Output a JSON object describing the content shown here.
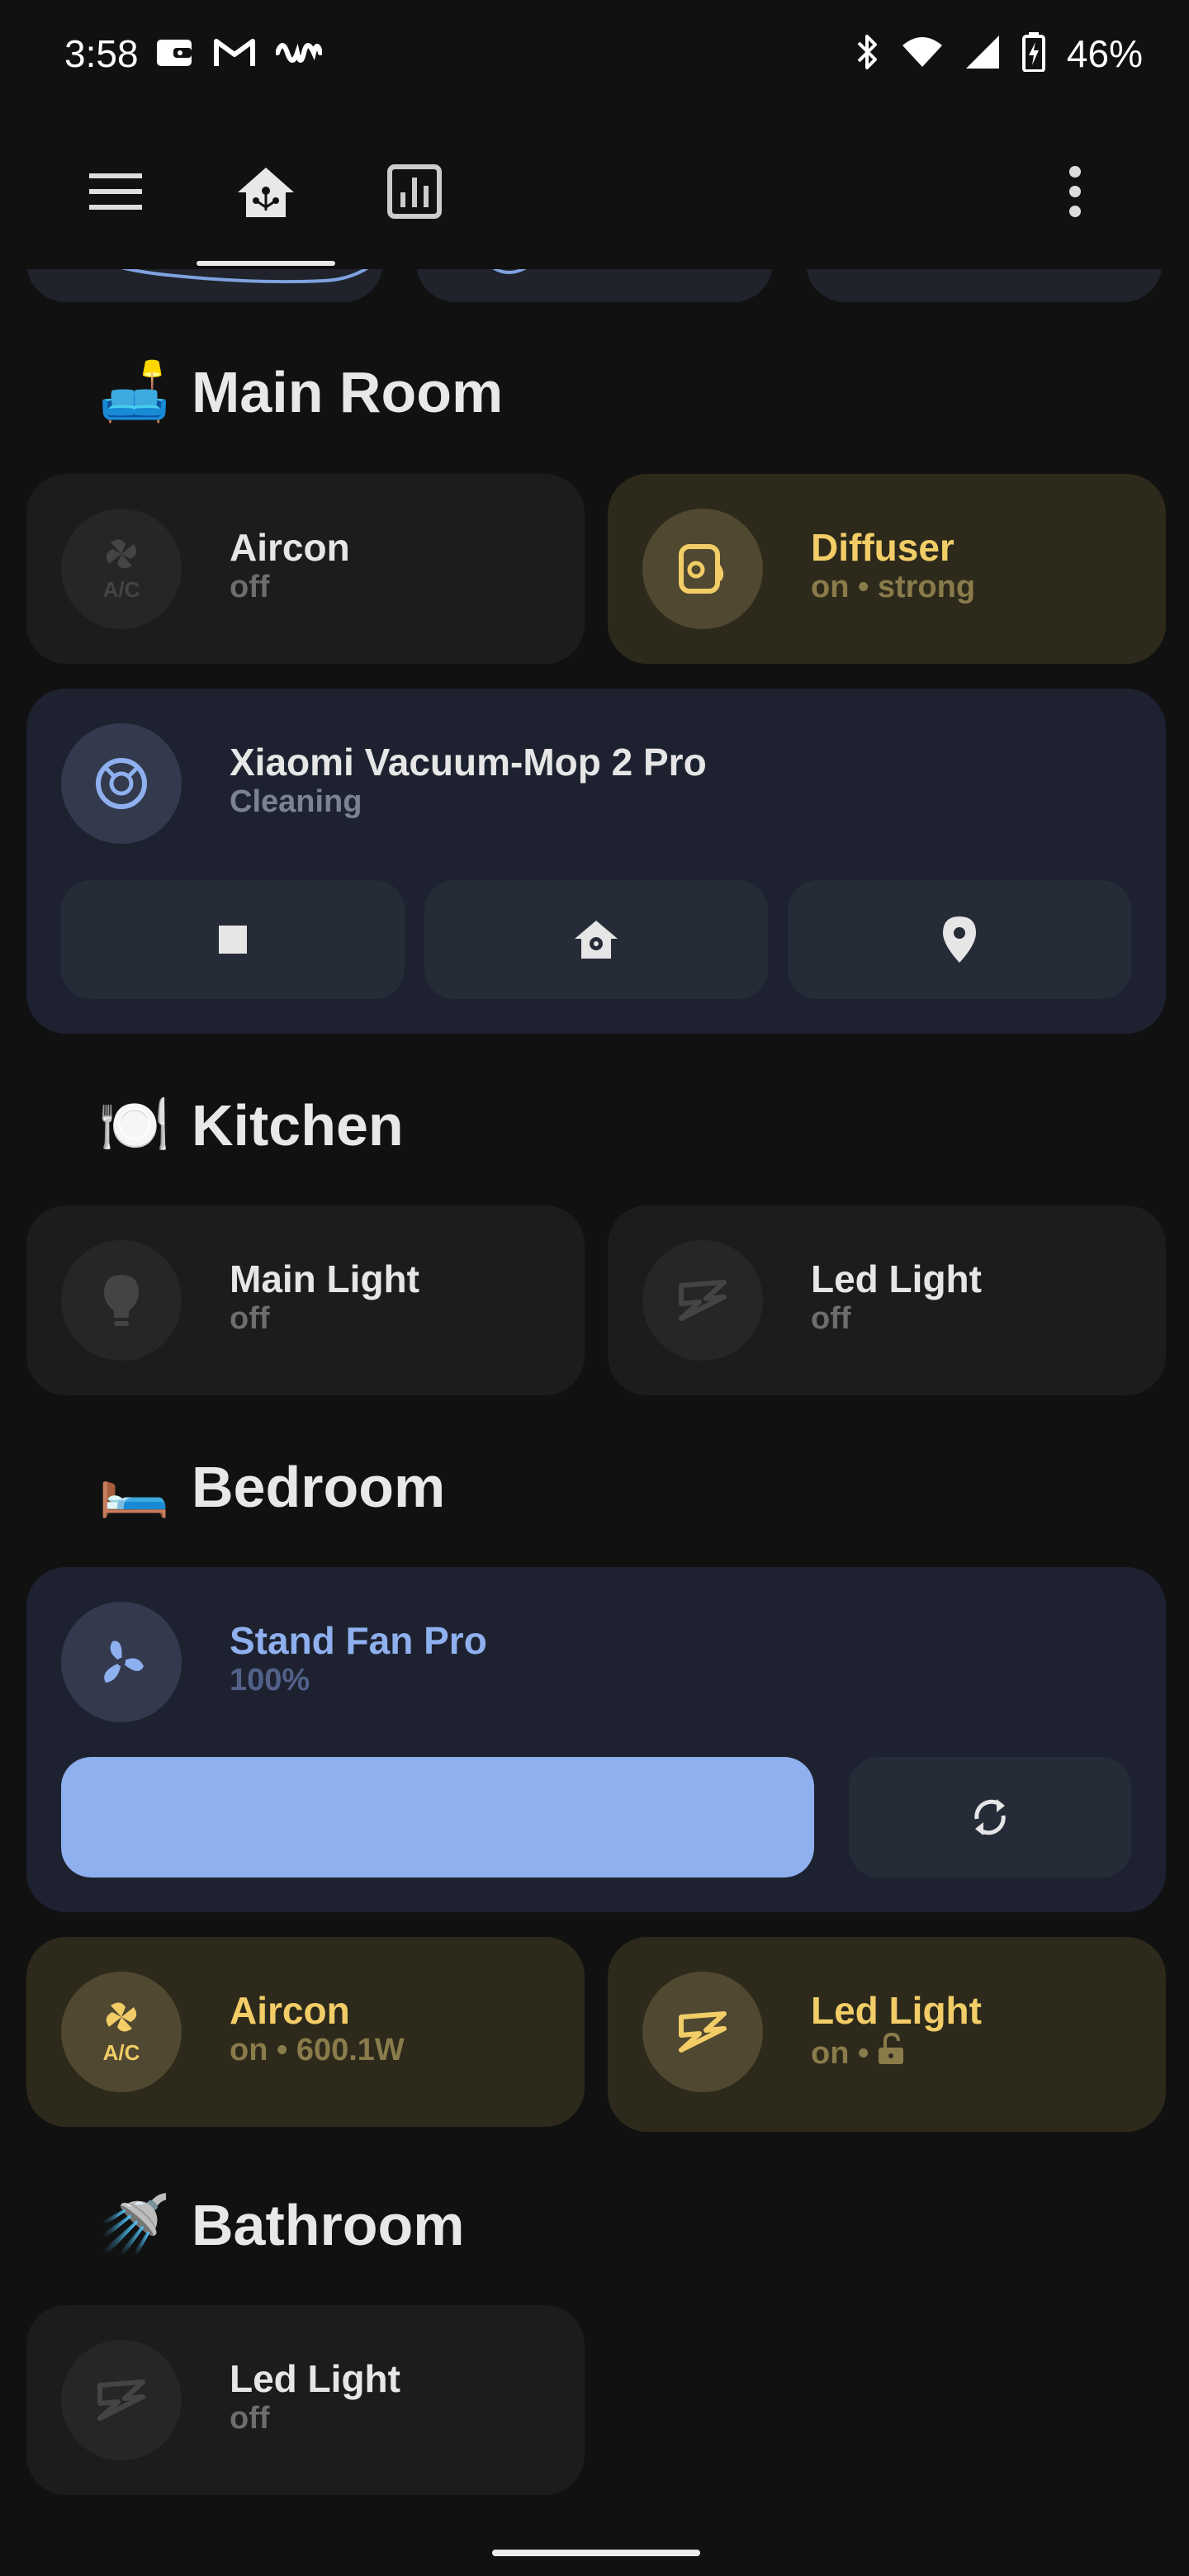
{
  "status_bar": {
    "time": "3:58",
    "notification_icons": [
      "wallet-icon",
      "gmail-icon",
      "waveform-icon"
    ],
    "right_icons": [
      "bluetooth-icon",
      "wifi-icon",
      "signal-icon",
      "battery-charging-icon"
    ],
    "battery_percent": "46%"
  },
  "app_bar": {
    "menu_icon": "hamburger-menu-icon",
    "tabs": [
      {
        "icon": "home-icon",
        "selected": true
      },
      {
        "icon": "chart-icon",
        "selected": false
      }
    ],
    "overflow_icon": "more-vertical-icon"
  },
  "sections": {
    "main_room": {
      "emoji": "🛋️",
      "title": "Main Room"
    },
    "kitchen": {
      "emoji": "🍽️",
      "title": "Kitchen"
    },
    "bedroom": {
      "emoji": "🛏️",
      "title": "Bedroom"
    },
    "bathroom": {
      "emoji": "🚿",
      "title": "Bathroom"
    }
  },
  "tiles": {
    "main_aircon": {
      "name": "Aircon",
      "state": "off",
      "icon": "air-conditioner-icon"
    },
    "main_diffuser": {
      "name": "Diffuser",
      "state": "on • strong",
      "icon": "diffuser-icon"
    },
    "vacuum": {
      "name": "Xiaomi Vacuum-Mop 2 Pro",
      "state": "Cleaning",
      "icon": "robot-vacuum-icon",
      "buttons": [
        "stop-icon",
        "return-home-icon",
        "locate-icon"
      ]
    },
    "kitchen_main_light": {
      "name": "Main Light",
      "state": "off",
      "icon": "lightbulb-icon"
    },
    "kitchen_led_light": {
      "name": "Led Light",
      "state": "off",
      "icon": "led-strip-icon"
    },
    "stand_fan": {
      "name": "Stand Fan Pro",
      "state": "100%",
      "icon": "fan-icon",
      "speed_percent": 100,
      "oscillate_icon": "oscillate-icon"
    },
    "bedroom_aircon": {
      "name": "Aircon",
      "state": "on • 600.1W",
      "icon": "air-conditioner-icon"
    },
    "bedroom_led_light": {
      "name": "Led Light",
      "state": "on •",
      "icon": "led-strip-icon",
      "extra_icon": "lock-open-icon"
    },
    "bathroom_led_light": {
      "name": "Led Light",
      "state": "off",
      "icon": "led-strip-icon"
    }
  },
  "colors": {
    "background": "#111111",
    "tile_off": "#1c1c1c",
    "tile_on_yellow": "#2d2a1c",
    "accent_yellow": "#f2cd67",
    "accent_blue": "#8fb0ef",
    "fan_slider": "#8fb0ef"
  }
}
